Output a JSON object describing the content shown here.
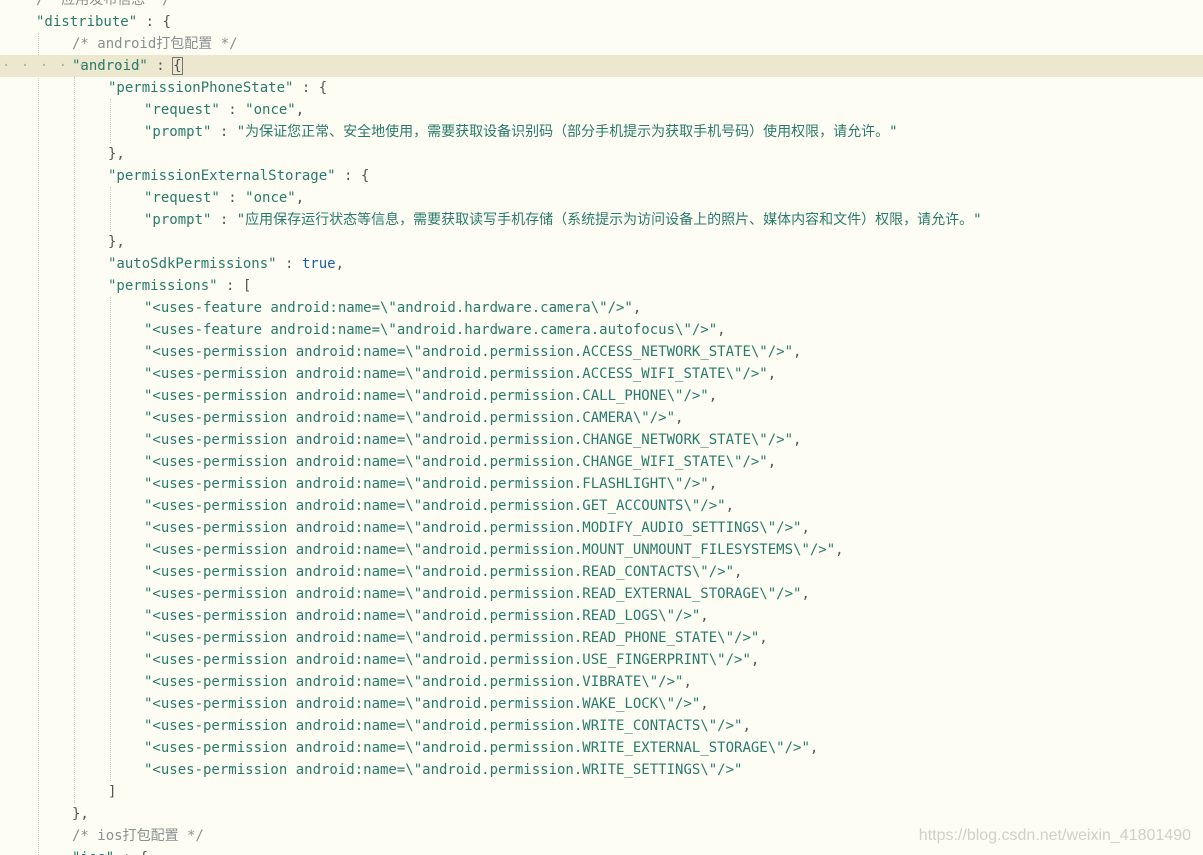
{
  "editor": {
    "lines": [
      {
        "indent": 1,
        "text": "/* 应用发布信息 */",
        "kind": "comment"
      },
      {
        "indent": 1,
        "key": "distribute",
        "suffix": " : {",
        "kind": "key-open"
      },
      {
        "indent": 2,
        "text": "/* android打包配置 */",
        "kind": "comment"
      },
      {
        "indent": 2,
        "key": "android",
        "suffix": " : {",
        "kind": "key-open",
        "active": true
      },
      {
        "indent": 3,
        "key": "permissionPhoneState",
        "suffix": " : {",
        "kind": "key-open"
      },
      {
        "indent": 4,
        "key": "request",
        "value": "once",
        "suffix": ",",
        "kind": "key-str"
      },
      {
        "indent": 4,
        "key": "prompt",
        "value": "为保证您正常、安全地使用，需要获取设备识别码（部分手机提示为获取手机号码）使用权限，请允许。",
        "suffix": "",
        "kind": "key-str"
      },
      {
        "indent": 3,
        "text": "},",
        "kind": "punc"
      },
      {
        "indent": 3,
        "key": "permissionExternalStorage",
        "suffix": " : {",
        "kind": "key-open"
      },
      {
        "indent": 4,
        "key": "request",
        "value": "once",
        "suffix": ",",
        "kind": "key-str"
      },
      {
        "indent": 4,
        "key": "prompt",
        "value": "应用保存运行状态等信息，需要获取读写手机存储（系统提示为访问设备上的照片、媒体内容和文件）权限，请允许。",
        "suffix": "",
        "kind": "key-str"
      },
      {
        "indent": 3,
        "text": "},",
        "kind": "punc"
      },
      {
        "indent": 3,
        "key": "autoSdkPermissions",
        "bool": "true",
        "suffix": ",",
        "kind": "key-bool"
      },
      {
        "indent": 3,
        "key": "permissions",
        "suffix": " : [",
        "kind": "key-open"
      },
      {
        "indent": 4,
        "value": "<uses-feature android:name=\\\"android.hardware.camera\\\"/>",
        "suffix": ",",
        "kind": "str"
      },
      {
        "indent": 4,
        "value": "<uses-feature android:name=\\\"android.hardware.camera.autofocus\\\"/>",
        "suffix": ",",
        "kind": "str"
      },
      {
        "indent": 4,
        "value": "<uses-permission android:name=\\\"android.permission.ACCESS_NETWORK_STATE\\\"/>",
        "suffix": ",",
        "kind": "str"
      },
      {
        "indent": 4,
        "value": "<uses-permission android:name=\\\"android.permission.ACCESS_WIFI_STATE\\\"/>",
        "suffix": ",",
        "kind": "str"
      },
      {
        "indent": 4,
        "value": "<uses-permission android:name=\\\"android.permission.CALL_PHONE\\\"/>",
        "suffix": ",",
        "kind": "str"
      },
      {
        "indent": 4,
        "value": "<uses-permission android:name=\\\"android.permission.CAMERA\\\"/>",
        "suffix": ",",
        "kind": "str"
      },
      {
        "indent": 4,
        "value": "<uses-permission android:name=\\\"android.permission.CHANGE_NETWORK_STATE\\\"/>",
        "suffix": ",",
        "kind": "str"
      },
      {
        "indent": 4,
        "value": "<uses-permission android:name=\\\"android.permission.CHANGE_WIFI_STATE\\\"/>",
        "suffix": ",",
        "kind": "str"
      },
      {
        "indent": 4,
        "value": "<uses-permission android:name=\\\"android.permission.FLASHLIGHT\\\"/>",
        "suffix": ",",
        "kind": "str"
      },
      {
        "indent": 4,
        "value": "<uses-permission android:name=\\\"android.permission.GET_ACCOUNTS\\\"/>",
        "suffix": ",",
        "kind": "str"
      },
      {
        "indent": 4,
        "value": "<uses-permission android:name=\\\"android.permission.MODIFY_AUDIO_SETTINGS\\\"/>",
        "suffix": ",",
        "kind": "str"
      },
      {
        "indent": 4,
        "value": "<uses-permission android:name=\\\"android.permission.MOUNT_UNMOUNT_FILESYSTEMS\\\"/>",
        "suffix": ",",
        "kind": "str"
      },
      {
        "indent": 4,
        "value": "<uses-permission android:name=\\\"android.permission.READ_CONTACTS\\\"/>",
        "suffix": ",",
        "kind": "str"
      },
      {
        "indent": 4,
        "value": "<uses-permission android:name=\\\"android.permission.READ_EXTERNAL_STORAGE\\\"/>",
        "suffix": ",",
        "kind": "str"
      },
      {
        "indent": 4,
        "value": "<uses-permission android:name=\\\"android.permission.READ_LOGS\\\"/>",
        "suffix": ",",
        "kind": "str"
      },
      {
        "indent": 4,
        "value": "<uses-permission android:name=\\\"android.permission.READ_PHONE_STATE\\\"/>",
        "suffix": ",",
        "kind": "str"
      },
      {
        "indent": 4,
        "value": "<uses-permission android:name=\\\"android.permission.USE_FINGERPRINT\\\"/>",
        "suffix": ",",
        "kind": "str"
      },
      {
        "indent": 4,
        "value": "<uses-permission android:name=\\\"android.permission.VIBRATE\\\"/>",
        "suffix": ",",
        "kind": "str"
      },
      {
        "indent": 4,
        "value": "<uses-permission android:name=\\\"android.permission.WAKE_LOCK\\\"/>",
        "suffix": ",",
        "kind": "str"
      },
      {
        "indent": 4,
        "value": "<uses-permission android:name=\\\"android.permission.WRITE_CONTACTS\\\"/>",
        "suffix": ",",
        "kind": "str"
      },
      {
        "indent": 4,
        "value": "<uses-permission android:name=\\\"android.permission.WRITE_EXTERNAL_STORAGE\\\"/>",
        "suffix": ",",
        "kind": "str"
      },
      {
        "indent": 4,
        "value": "<uses-permission android:name=\\\"android.permission.WRITE_SETTINGS\\\"/>",
        "suffix": "",
        "kind": "str"
      },
      {
        "indent": 3,
        "text": "]",
        "kind": "punc"
      },
      {
        "indent": 2,
        "text": "},",
        "kind": "punc"
      },
      {
        "indent": 2,
        "text": "/* ios打包配置 */",
        "kind": "comment"
      },
      {
        "indent": 2,
        "key": "ios",
        "suffix": " : {",
        "kind": "key-open"
      }
    ]
  },
  "watermark": "https://blog.csdn.net/weixin_41801490",
  "colors": {
    "background": "#fdfdf4",
    "active_line": "#ebe8cf",
    "string": "#2a7a6b",
    "comment": "#8a8f8f",
    "boolean": "#1b5fa8"
  }
}
